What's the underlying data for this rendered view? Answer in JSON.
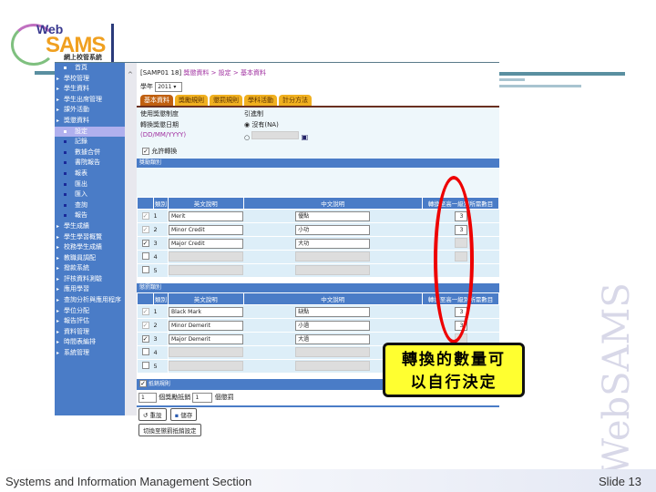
{
  "logo": {
    "web": "Web",
    "sams": "SAMS",
    "chinese": "網上校管系統"
  },
  "sidebar": {
    "items": [
      {
        "label": "首頁",
        "type": "sub"
      },
      {
        "label": "學校管理",
        "type": "top"
      },
      {
        "label": "學生資料",
        "type": "top"
      },
      {
        "label": "學生出席管理",
        "type": "top"
      },
      {
        "label": "課外活動",
        "type": "top"
      },
      {
        "label": "獎懲資料",
        "type": "top"
      },
      {
        "label": "設定",
        "type": "sub sel"
      },
      {
        "label": "記錄",
        "type": "sub blue"
      },
      {
        "label": "數據合併",
        "type": "sub blue"
      },
      {
        "label": "書院報告",
        "type": "sub blue"
      },
      {
        "label": "報表",
        "type": "sub blue"
      },
      {
        "label": "匯出",
        "type": "sub blue"
      },
      {
        "label": "匯入",
        "type": "sub blue"
      },
      {
        "label": "查詢",
        "type": "sub blue"
      },
      {
        "label": "報告",
        "type": "sub blue"
      },
      {
        "label": "學生成績",
        "type": "top"
      },
      {
        "label": "學生學習概覽",
        "type": "top"
      },
      {
        "label": "校務學生成績",
        "type": "top"
      },
      {
        "label": "教職員調配",
        "type": "top"
      },
      {
        "label": "撥款系統",
        "type": "top"
      },
      {
        "label": "評核資料測驗",
        "type": "top"
      },
      {
        "label": "應用學習",
        "type": "top"
      },
      {
        "label": "查詢分析與應用程序",
        "type": "top"
      },
      {
        "label": "學位分配",
        "type": "top"
      },
      {
        "label": "報告評估",
        "type": "top"
      },
      {
        "label": "資料管理",
        "type": "top"
      },
      {
        "label": "時間表編排",
        "type": "top"
      },
      {
        "label": "系統管理",
        "type": "top"
      }
    ]
  },
  "content": {
    "breadcrumb_code": "[SAMP01 18]",
    "breadcrumb_path": "獎懲資料 > 設定 > 基本資料",
    "year_label": "學年",
    "year_value": "2011",
    "tabs": [
      "基本資料",
      "獎勵規則",
      "懲罰規則",
      "學科活動",
      "計分方法"
    ],
    "field1": "使用獎懲制度",
    "field2": "轉換獎懲日期",
    "field2_fmt": "(DD/MM/YYYY)",
    "radio_label": "引進制",
    "radio_opt1": "沒有(NA)",
    "allow_convert": "允許轉換",
    "merit_title": "獎勵類別",
    "headers": [
      "類別",
      "英文說明",
      "中文說明",
      "轉換至高一級別所需數目"
    ],
    "merit_rows": [
      {
        "n": "1",
        "en": "Merit",
        "zh": "優點",
        "count": "3",
        "checked": "true"
      },
      {
        "n": "2",
        "en": "Minor Credit",
        "zh": "小功",
        "count": "3",
        "checked": "true"
      },
      {
        "n": "3",
        "en": "Major Credit",
        "zh": "大功",
        "count": "",
        "checked": "true"
      },
      {
        "n": "4",
        "en": "",
        "zh": "",
        "count": "",
        "checked": "false"
      },
      {
        "n": "5",
        "en": "",
        "zh": "",
        "count": "",
        "checked": "false"
      }
    ],
    "demerit_title": "懲罰類別",
    "demerit_rows": [
      {
        "n": "1",
        "en": "Black Mark",
        "zh": "缺點",
        "count": "3",
        "checked": "true"
      },
      {
        "n": "2",
        "en": "Minor Demerit",
        "zh": "小過",
        "count": "3",
        "checked": "true"
      },
      {
        "n": "3",
        "en": "Major Demerit",
        "zh": "大過",
        "count": "",
        "checked": "true"
      },
      {
        "n": "4",
        "en": "",
        "zh": "",
        "count": "",
        "checked": "false"
      },
      {
        "n": "5",
        "en": "",
        "zh": "",
        "count": "",
        "checked": "false"
      }
    ],
    "offset_title": "抵銷規則",
    "offset_a": "1",
    "offset_mid": "個獎勵抵銷",
    "offset_b": "1",
    "offset_end": "個懲罰",
    "btn_reset": "重設",
    "btn_save": "儲存",
    "btn_other": "切換至懲罰抵銷設定"
  },
  "callout": {
    "line1": "轉換的數量可",
    "line2": "以自行決定"
  },
  "watermark": "WebSAMS",
  "footer": {
    "left": "Systems and Information Management Section",
    "right": "Slide 13"
  }
}
